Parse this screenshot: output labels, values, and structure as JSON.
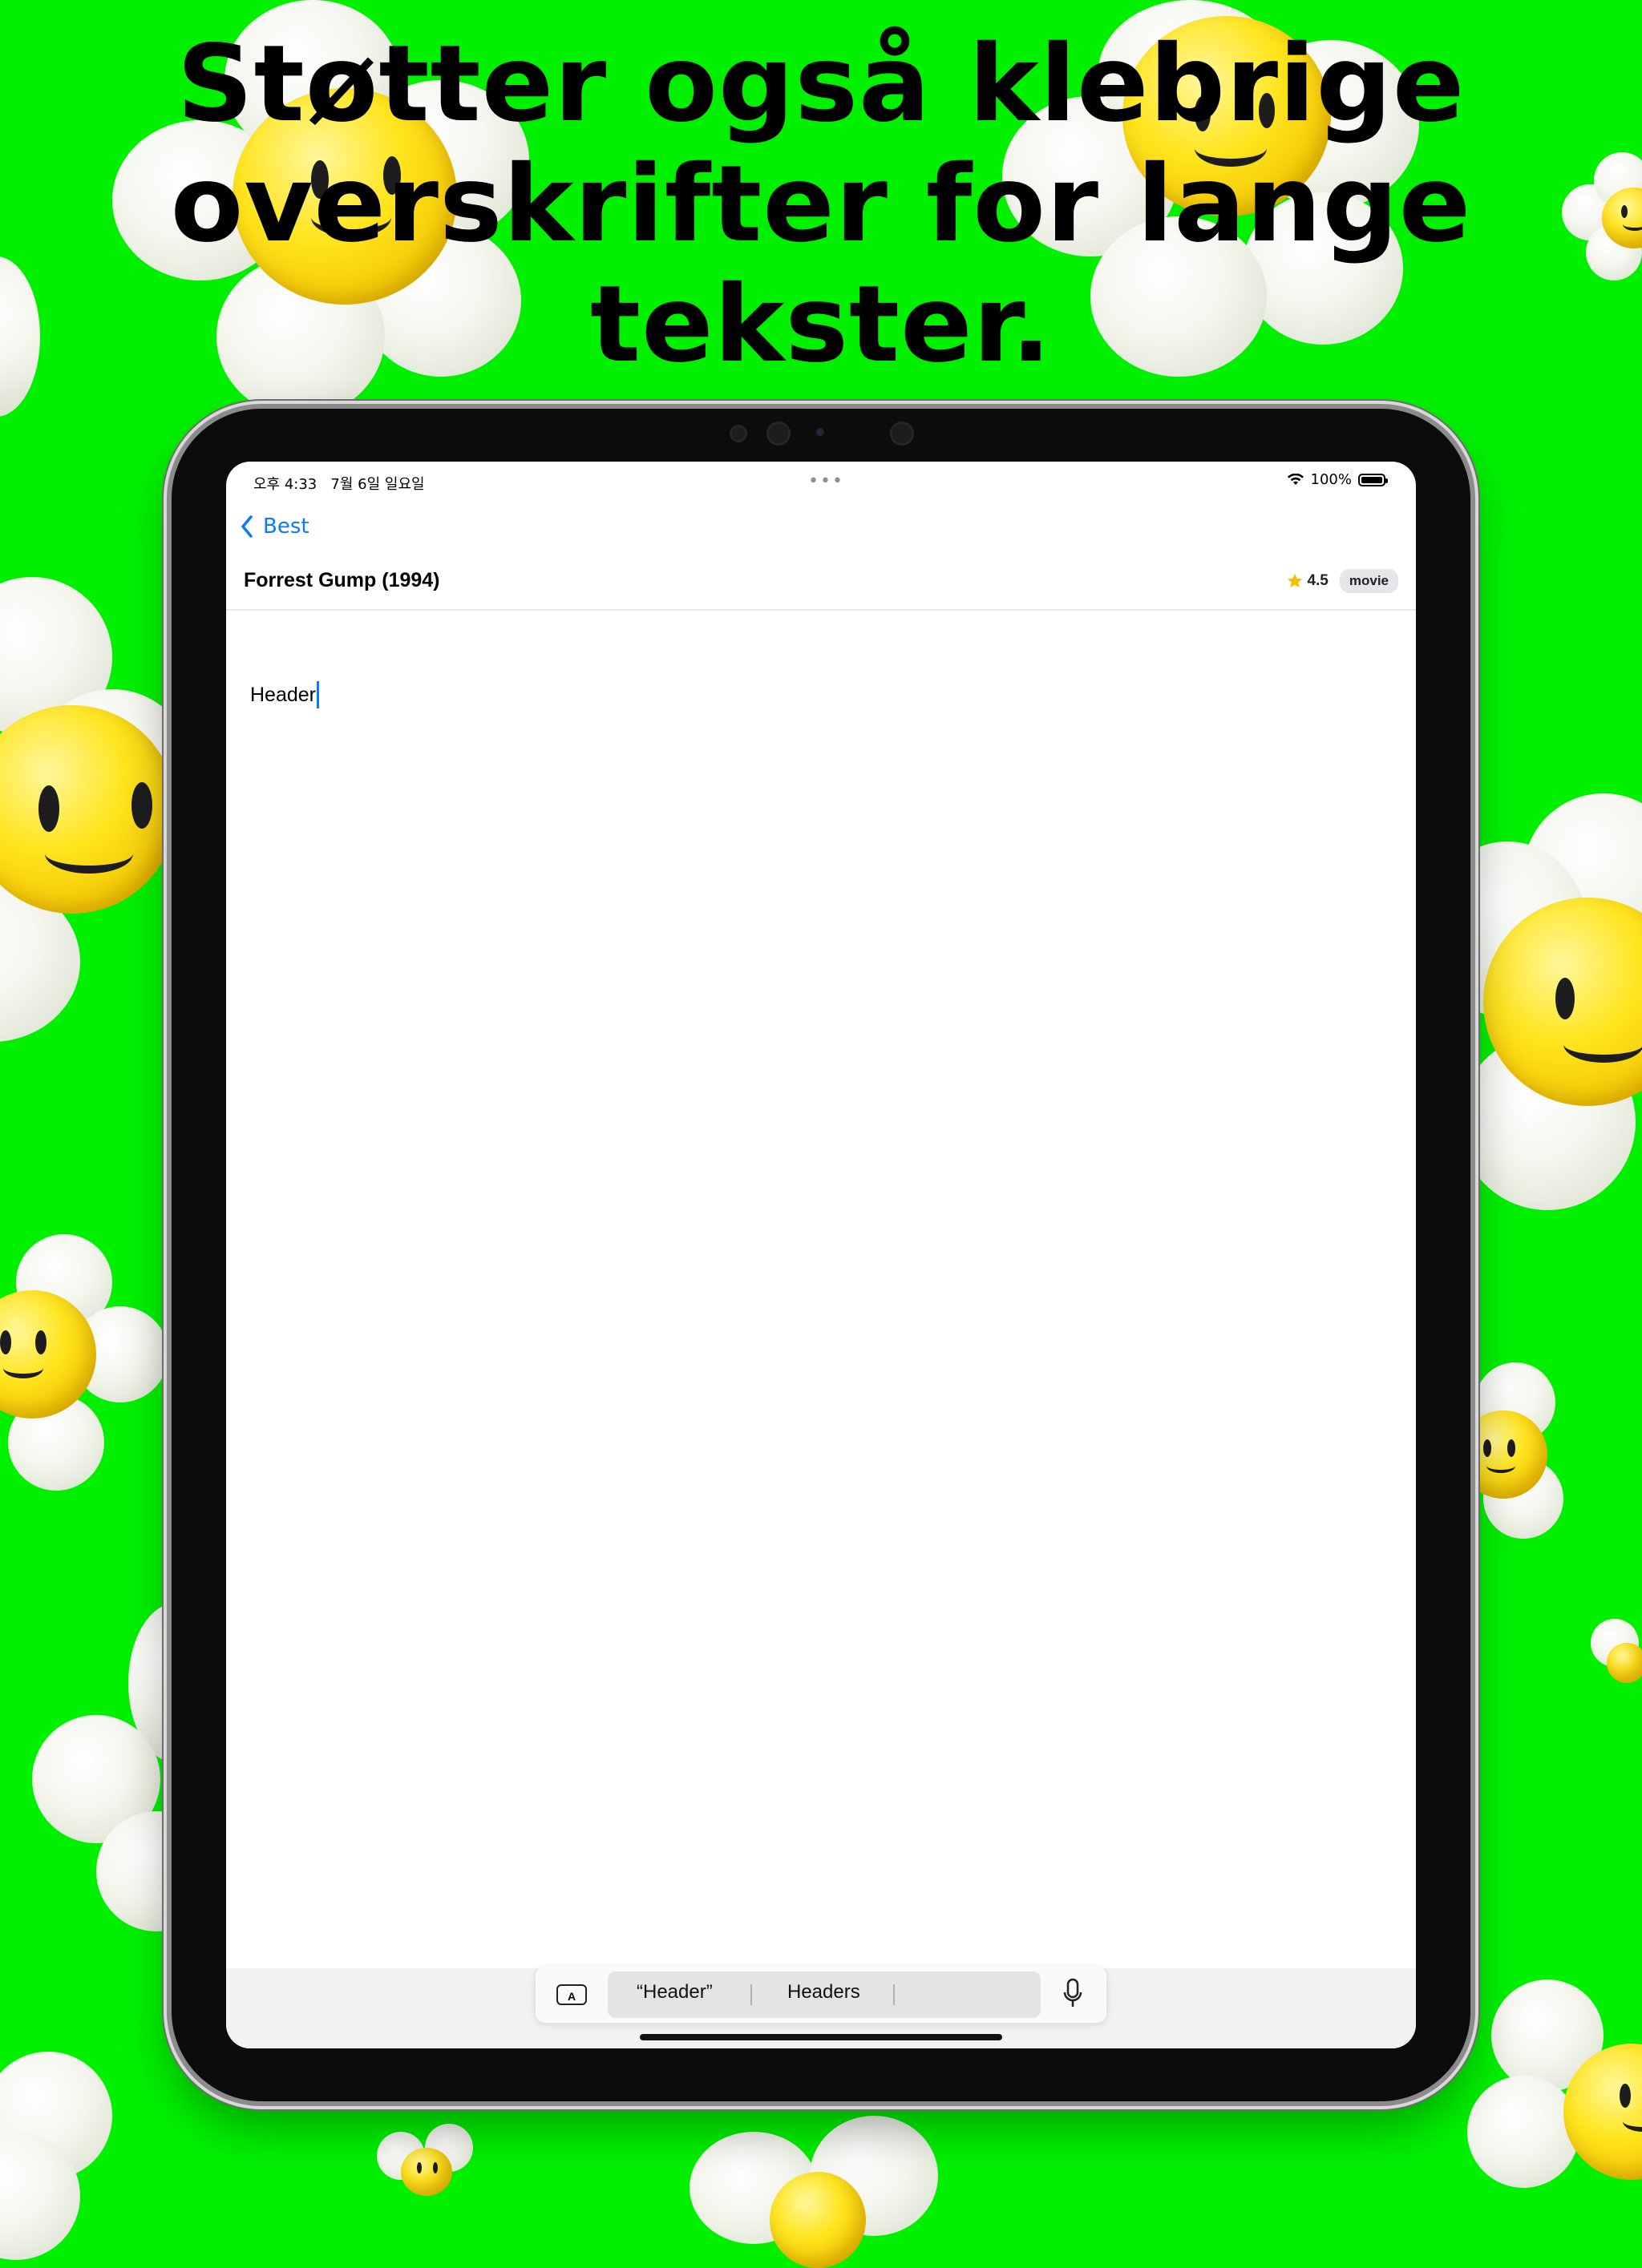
{
  "headline": "Støtter også klebrige overskrifter for lange tekster.",
  "status_bar": {
    "time_date": "오후 4:33   7월 6일 일요일",
    "dots": "•••",
    "wifi_icon": "wifi-icon",
    "battery_text": "100%"
  },
  "nav": {
    "back_label": "Best",
    "back_icon": "chevron-left-icon"
  },
  "title_bar": {
    "title": "Forrest Gump (1994)",
    "rating": "4.5",
    "badge": "movie",
    "star_icon": "star-icon"
  },
  "editor": {
    "text": "Header"
  },
  "quicktype": {
    "suggestions": [
      "“Header”",
      "Headers",
      ""
    ],
    "keyboard_icon": "keyboard-icon",
    "mic_icon": "microphone-icon"
  },
  "colors": {
    "background": "#00f000",
    "accent": "#0a7aff",
    "star": "#f5c000"
  }
}
